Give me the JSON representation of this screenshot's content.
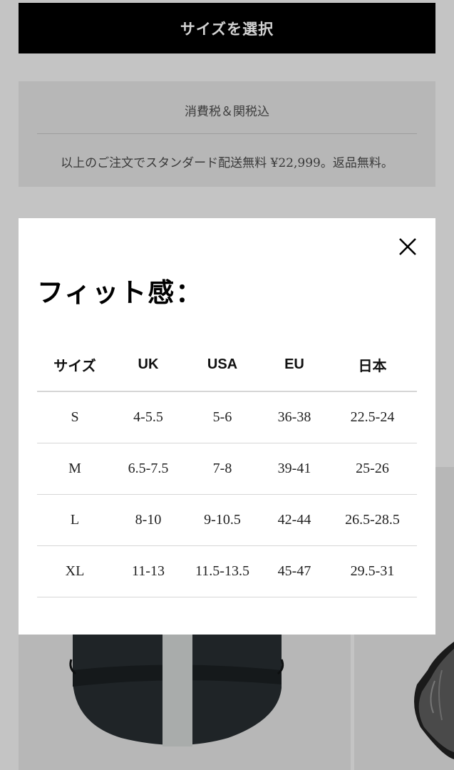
{
  "header": {
    "select_size_label": "サイズを選択"
  },
  "info": {
    "tax_text": "消費税＆関税込",
    "shipping_text": "以上のご注文でスタンダード配送無料 ¥22,999。返品無料。"
  },
  "modal": {
    "title": "フィット感：",
    "close_icon": "close-icon",
    "table": {
      "headers": [
        "サイズ",
        "UK",
        "USA",
        "EU",
        "日本"
      ],
      "rows": [
        [
          "S",
          "4-5.5",
          "5-6",
          "36-38",
          "22.5-24"
        ],
        [
          "M",
          "6.5-7.5",
          "7-8",
          "39-41",
          "25-26"
        ],
        [
          "L",
          "8-10",
          "9-10.5",
          "42-44",
          "26.5-28.5"
        ],
        [
          "XL",
          "11-13",
          "11.5-13.5",
          "45-47",
          "29.5-31"
        ]
      ]
    }
  }
}
